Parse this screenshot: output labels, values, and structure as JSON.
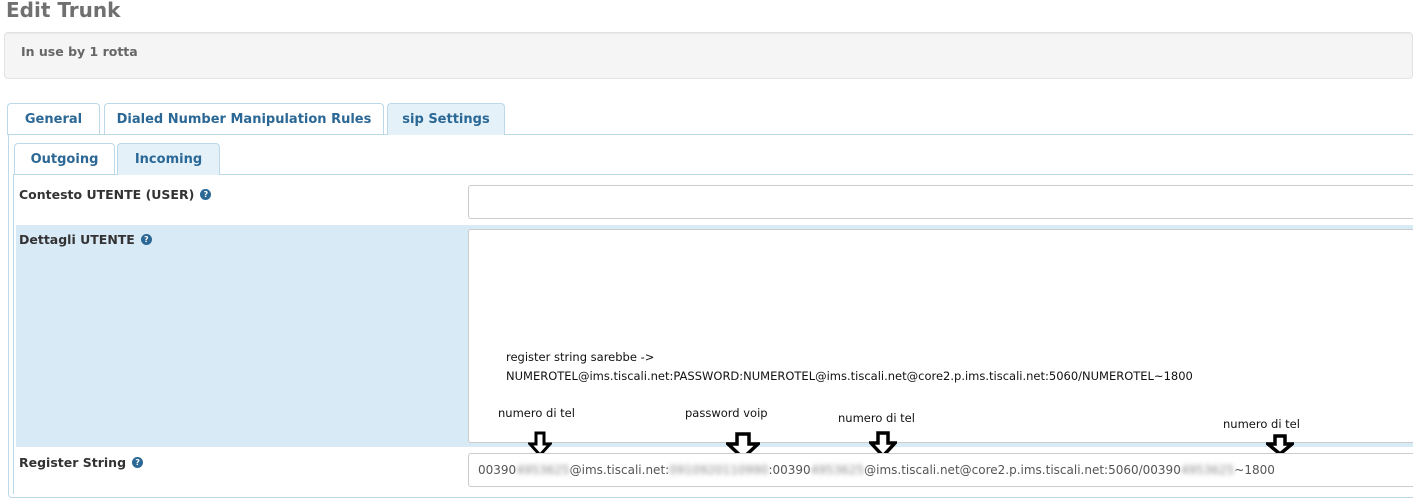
{
  "page": {
    "title": "Edit Trunk",
    "in_use": "In use by 1 rotta"
  },
  "tabs": {
    "main": [
      {
        "label": "General"
      },
      {
        "label": "Dialed Number Manipulation Rules"
      },
      {
        "label": "sip Settings"
      }
    ],
    "sub": [
      {
        "label": "Outgoing"
      },
      {
        "label": "Incoming"
      }
    ],
    "active_main": "sip Settings",
    "active_sub": "Incoming"
  },
  "fields": {
    "user_context": {
      "label": "Contesto UTENTE (USER)",
      "value": ""
    },
    "user_details": {
      "label": "Dettagli UTENTE",
      "value": ""
    },
    "register_string": {
      "label": "Register String",
      "part1": "00390",
      "blur1": "4953625",
      "part2": "@ims.tiscali.net:",
      "blur2": "0910920110990",
      "part3": ":00390",
      "blur3": "4953625",
      "part4": "@ims.tiscali.net@core2.p.ims.tiscali.net:5060/00390",
      "blur4": "4953625",
      "part5": "~1800"
    }
  },
  "annotations": {
    "line1": "register string sarebbe ->",
    "line2": "NUMEROTEL@ims.tiscali.net:PASSWORD:NUMEROTEL@ims.tiscali.net@core2.p.ims.tiscali.net:5060/NUMEROTEL~1800",
    "numero1": "numero di tel",
    "password": "password voip",
    "numero2": "numero di tel",
    "numero3": "numero di tel"
  },
  "icons": {
    "help": "question-circle-icon",
    "arrow": "down-arrow-icon"
  },
  "colors": {
    "tab_text": "#2b6896",
    "active_tab_bg": "#e4f1f9",
    "highlight_row": "#d9eaf7",
    "border": "#bcd9ea"
  }
}
